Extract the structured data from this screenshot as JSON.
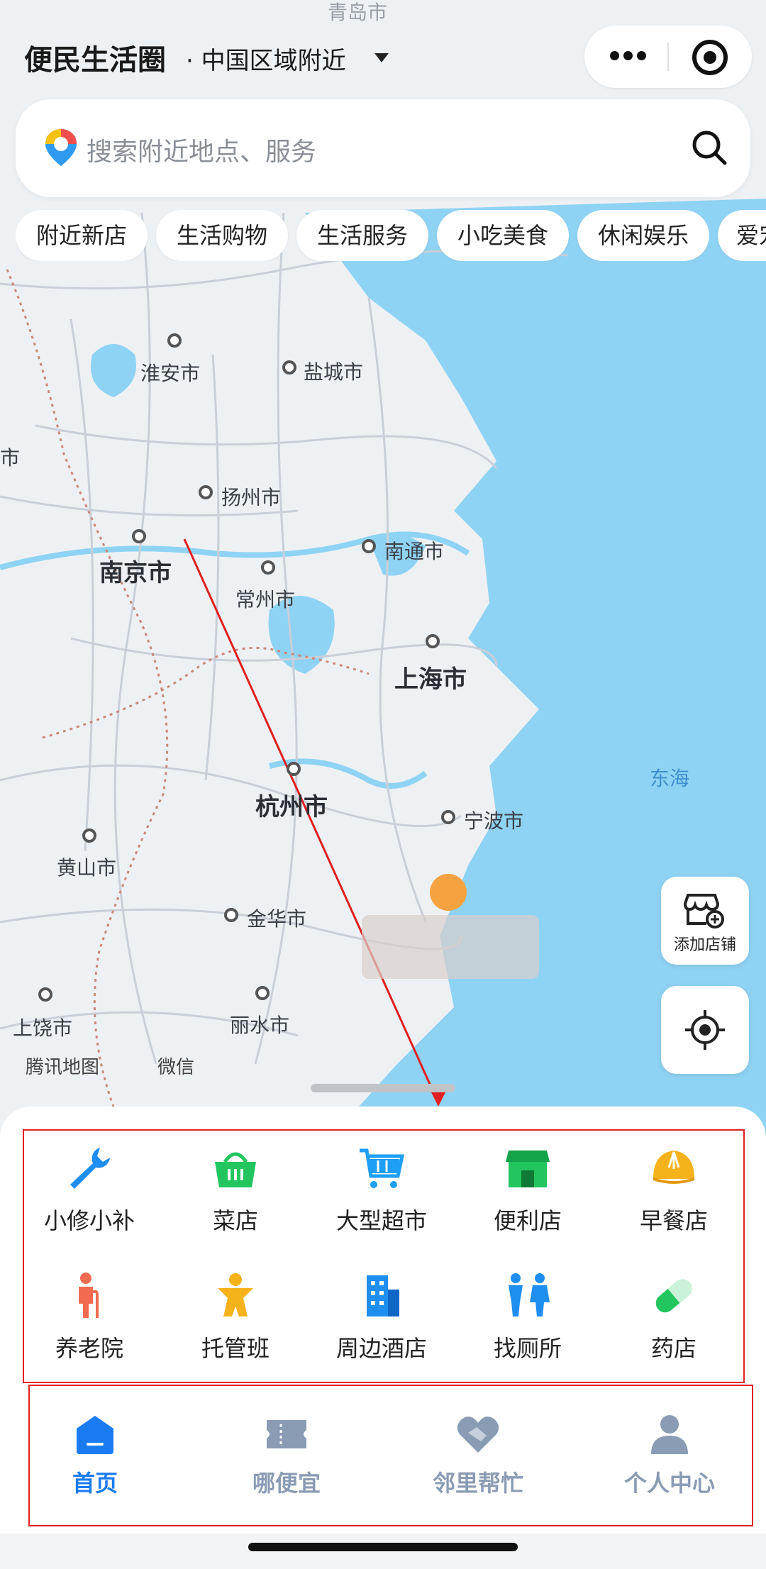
{
  "header": {
    "title": "便民生活圈",
    "subtitle": "· 中国区域附近"
  },
  "search": {
    "placeholder": "搜索附近地点、服务"
  },
  "chips": [
    "附近新店",
    "生活购物",
    "生活服务",
    "小吃美食",
    "休闲娱乐",
    "爱宠"
  ],
  "map": {
    "cities": [
      "淮安市",
      "盐城市",
      "扬州市",
      "南京市",
      "常州市",
      "南通市",
      "上海市",
      "杭州市",
      "宁波市",
      "黄山市",
      "金华市",
      "上饶市",
      "丽水市",
      "市",
      "青岛市"
    ],
    "sea": "东海",
    "attribution": [
      "腾讯地图",
      "微信"
    ]
  },
  "side_buttons": {
    "add_shop": "添加店铺"
  },
  "services": [
    {
      "label": "小修小补",
      "icon": "wrench-icon",
      "color": "#1e8ef0"
    },
    {
      "label": "菜店",
      "icon": "basket-icon",
      "color": "#22c55e"
    },
    {
      "label": "大型超市",
      "icon": "cart-icon",
      "color": "#1e9ef5"
    },
    {
      "label": "便利店",
      "icon": "store-icon",
      "color": "#22c55e"
    },
    {
      "label": "早餐店",
      "icon": "bun-icon",
      "color": "#f6b21b"
    },
    {
      "label": "养老院",
      "icon": "elder-icon",
      "color": "#f26b50"
    },
    {
      "label": "托管班",
      "icon": "child-icon",
      "color": "#f6b21b"
    },
    {
      "label": "周边酒店",
      "icon": "building-icon",
      "color": "#1e8ef0"
    },
    {
      "label": "找厕所",
      "icon": "restroom-icon",
      "color": "#1e8ef0"
    },
    {
      "label": "药店",
      "icon": "pill-icon",
      "color": "#22c55e"
    }
  ],
  "tabs": [
    {
      "label": "首页",
      "icon": "home-icon",
      "active": true
    },
    {
      "label": "哪便宜",
      "icon": "ticket-icon",
      "active": false
    },
    {
      "label": "邻里帮忙",
      "icon": "handshake-icon",
      "active": false
    },
    {
      "label": "个人中心",
      "icon": "person-icon",
      "active": false
    }
  ],
  "colors": {
    "accent": "#1a7cf0",
    "inactive": "#8a9bb4",
    "sea": "#8fd3f4",
    "highlight_box": "#e02020"
  }
}
